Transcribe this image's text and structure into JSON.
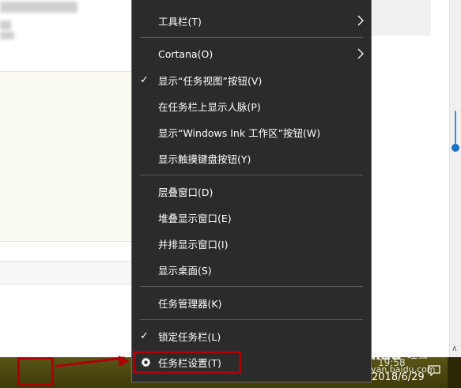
{
  "menu": {
    "items": [
      {
        "label": "工具栏(T)",
        "checked": false,
        "submenu": true
      },
      {
        "label": "Cortana(O)",
        "checked": false,
        "submenu": true
      },
      {
        "label": "显示“任务视图”按钮(V)",
        "checked": true,
        "submenu": false
      },
      {
        "label": "在任务栏上显示人脉(P)",
        "checked": false,
        "submenu": false
      },
      {
        "label": "显示“Windows Ink 工作区”按钮(W)",
        "checked": false,
        "submenu": false
      },
      {
        "label": "显示触摸键盘按钮(Y)",
        "checked": false,
        "submenu": false
      },
      {
        "label": "层叠窗口(D)",
        "checked": false,
        "submenu": false
      },
      {
        "label": "堆叠显示窗口(E)",
        "checked": false,
        "submenu": false
      },
      {
        "label": "并排显示窗口(I)",
        "checked": false,
        "submenu": false
      },
      {
        "label": "显示桌面(S)",
        "checked": false,
        "submenu": false
      },
      {
        "label": "任务管理器(K)",
        "checked": false,
        "submenu": false
      },
      {
        "label": "锁定任务栏(L)",
        "checked": true,
        "submenu": false
      },
      {
        "label": "任务栏设置(T)",
        "checked": false,
        "submenu": false,
        "icon": "gear-icon"
      }
    ],
    "check_glyph": "✓"
  },
  "taskbar": {
    "time": "19:58",
    "date": "2018/6/29",
    "tray_icon": "action-center-icon"
  },
  "watermark": {
    "logo": "Baidu",
    "label": "经验",
    "url": "jingyan.baidu.com"
  },
  "colors": {
    "menu_bg": "#2b2b2b",
    "taskbar_bg": "#4a4510",
    "highlight_border": "#b0000a",
    "scroll_accent": "#1a73c9"
  }
}
